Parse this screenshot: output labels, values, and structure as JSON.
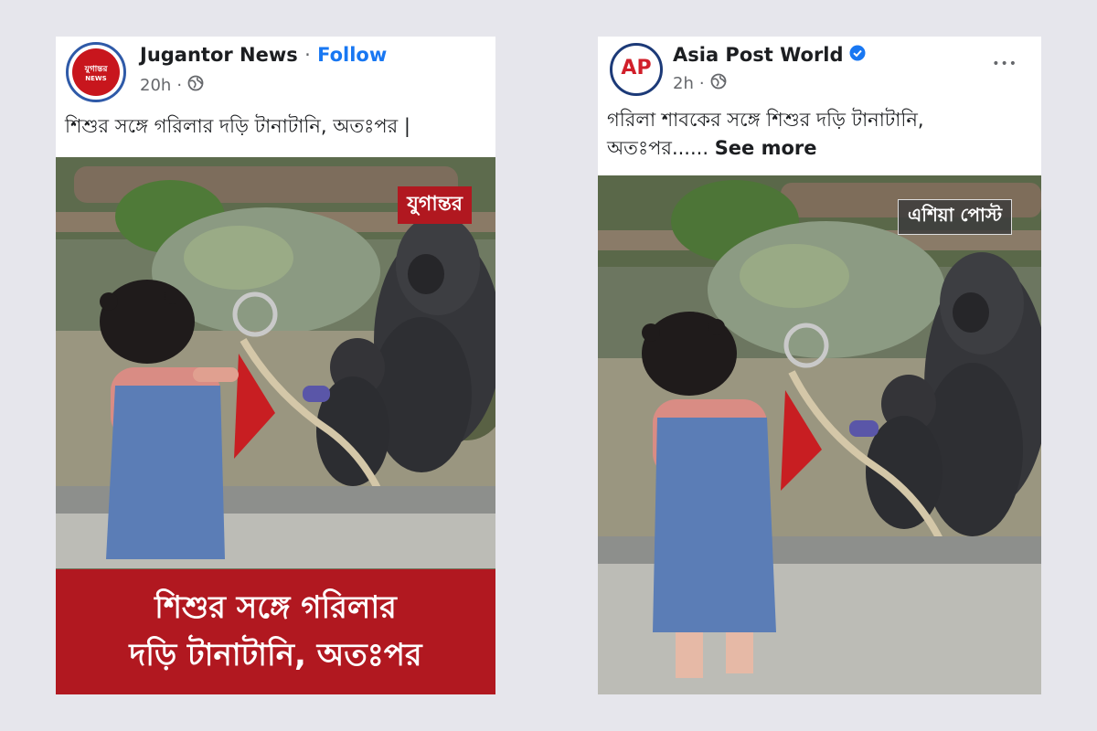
{
  "left_post": {
    "avatar_text": "যুগান্তর",
    "avatar_subtext": "NEWS",
    "page_name": "Jugantor News",
    "separator": "·",
    "follow_label": "Follow",
    "time": "20h",
    "audience_icon": "globe-icon",
    "caption": "শিশুর সঙ্গে গরিলার দড়ি টানাটানি, অতঃপর |",
    "watermark": "যুগান্তর",
    "banner_line1": "শিশুর সঙ্গে গরিলার",
    "banner_line2": "দড়ি টানাটানি, অতঃপর",
    "brand_color": "#b11820"
  },
  "right_post": {
    "avatar_text": "AP",
    "page_name": "Asia Post World",
    "verified_icon": "verified-badge-icon",
    "time": "2h",
    "audience_icon": "globe-icon",
    "more_icon": "more-options-icon",
    "more_glyph": "•••",
    "caption_line1": "গরিলা শাবকের সঙ্গে শিশুর দড়ি টানাটানি,",
    "caption_line2": "অতঃপর......",
    "see_more_label": "See more",
    "watermark": "এশিয়া পোস্ট"
  },
  "colors": {
    "link_blue": "#1877f2",
    "page_bg": "#e6e6ec",
    "meta_gray": "#65676b"
  }
}
